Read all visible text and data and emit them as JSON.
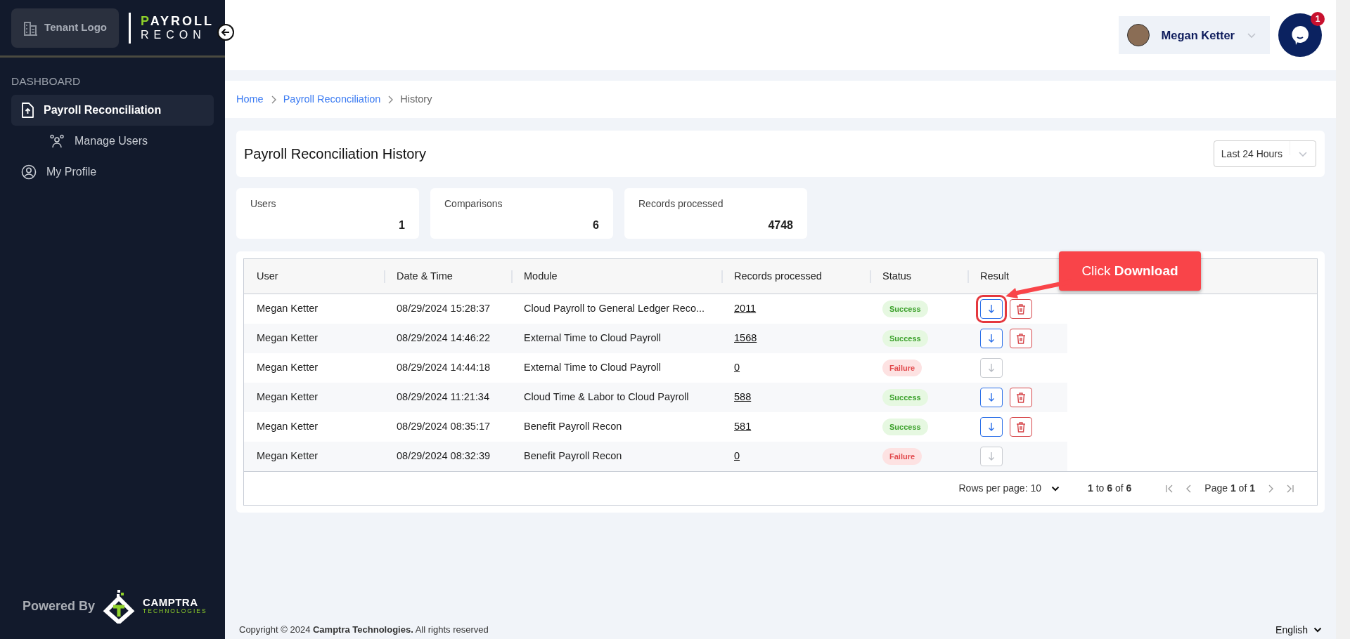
{
  "sidebar": {
    "tenant_logo": "Tenant Logo",
    "app_logo": {
      "line1": "PAYROLL",
      "line2": "RECON"
    },
    "section": "DASHBOARD",
    "items": [
      {
        "label": "Payroll Reconciliation",
        "selected": true,
        "children": [
          {
            "label": "Manage Users",
            "selected": false
          }
        ]
      },
      {
        "label": "My Profile",
        "selected": false
      }
    ],
    "powered_by": {
      "label": "Powered By",
      "brand": "CAMPTRA",
      "tagline": "TECHNOLOGIES"
    }
  },
  "header": {
    "user": {
      "name": "Megan Ketter"
    },
    "chat": {
      "badge": "1"
    }
  },
  "breadcrumb": [
    {
      "label": "Home",
      "current": false
    },
    {
      "label": "Payroll Reconciliation",
      "current": false
    },
    {
      "label": "History",
      "current": true
    }
  ],
  "page": {
    "title": "Payroll Reconciliation History",
    "range_select": {
      "value": "Last 24 Hours"
    }
  },
  "stats": [
    {
      "label": "Users",
      "value": "1"
    },
    {
      "label": "Comparisons",
      "value": "6"
    },
    {
      "label": "Records processed",
      "value": "4748"
    }
  ],
  "table": {
    "columns": [
      "User",
      "Date & Time",
      "Module",
      "Records processed",
      "Status",
      "Result"
    ],
    "rows": [
      {
        "user": "Megan Ketter",
        "date_time": "08/29/2024 15:28:37",
        "module": "Cloud Payroll to General Ledger Reco...",
        "records": "2011",
        "status": {
          "label": "Success",
          "kind": "success"
        },
        "download_enabled": true,
        "can_delete": true
      },
      {
        "user": "Megan Ketter",
        "date_time": "08/29/2024 14:46:22",
        "module": "External Time to Cloud Payroll",
        "records": "1568",
        "status": {
          "label": "Success",
          "kind": "success"
        },
        "download_enabled": true,
        "can_delete": true
      },
      {
        "user": "Megan Ketter",
        "date_time": "08/29/2024 14:44:18",
        "module": "External Time to Cloud Payroll",
        "records": "0",
        "status": {
          "label": "Failure",
          "kind": "failure"
        },
        "download_enabled": false,
        "can_delete": false
      },
      {
        "user": "Megan Ketter",
        "date_time": "08/29/2024 11:21:34",
        "module": "Cloud Time & Labor to Cloud Payroll",
        "records": "588",
        "status": {
          "label": "Success",
          "kind": "success"
        },
        "download_enabled": true,
        "can_delete": true
      },
      {
        "user": "Megan Ketter",
        "date_time": "08/29/2024 08:35:17",
        "module": "Benefit Payroll Recon",
        "records": "581",
        "status": {
          "label": "Success",
          "kind": "success"
        },
        "download_enabled": true,
        "can_delete": true
      },
      {
        "user": "Megan Ketter",
        "date_time": "08/29/2024 08:32:39",
        "module": "Benefit Payroll Recon",
        "records": "0",
        "status": {
          "label": "Failure",
          "kind": "failure"
        },
        "download_enabled": false,
        "can_delete": false
      }
    ],
    "pagination": {
      "rows_per_page": "Rows per page: 10",
      "range": "**1** to **6** of **6**",
      "page": "Page **1** of **1**"
    }
  },
  "callout": {
    "text": "Click **Download**"
  },
  "footer": {
    "copyright": "Copyright © 2024  **Camptra Technologies.**  All rights reserved",
    "language": "English"
  }
}
